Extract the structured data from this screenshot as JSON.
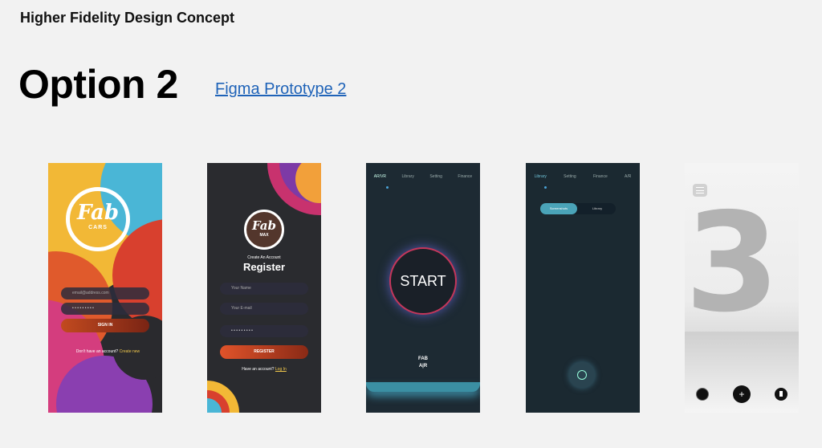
{
  "page": {
    "header": "Higher Fidelity Design Concept",
    "title": "Option 2",
    "link": "Figma Prototype 2"
  },
  "screens": {
    "s1": {
      "logo": "Fab",
      "logo_sub": "CARS",
      "email_placeholder": "email@address.com",
      "password_dots": "• • • • • • • • •",
      "signin": "SIGN IN",
      "footer_text": "Don't have an account?",
      "footer_link": "Create new"
    },
    "s2": {
      "logo": "Fab",
      "logo_sub": "MAX",
      "subtitle": "Create An Account",
      "title": "Register",
      "name_placeholder": "Your Name",
      "email_placeholder": "Your E-mail",
      "password_dots": "• • • • • • • • •",
      "register": "REGISTER",
      "footer_text": "Have an account?",
      "footer_link": "Log In"
    },
    "s3": {
      "tabs": [
        "AR/VR",
        "Library",
        "Setting",
        "Finance"
      ],
      "start": "START",
      "brand_line1": "FAB",
      "brand_line2": "A|R"
    },
    "s4": {
      "tabs": [
        "Library",
        "Setting",
        "Finance",
        "A/R"
      ],
      "toggle_active": "Screenshots",
      "toggle_inactive": "Library"
    },
    "s5": {
      "wall_number": "3"
    }
  },
  "colors": {
    "link": "#1f63b8",
    "accent_orange": "#e0532a",
    "accent_teal": "#4aa3b8"
  }
}
